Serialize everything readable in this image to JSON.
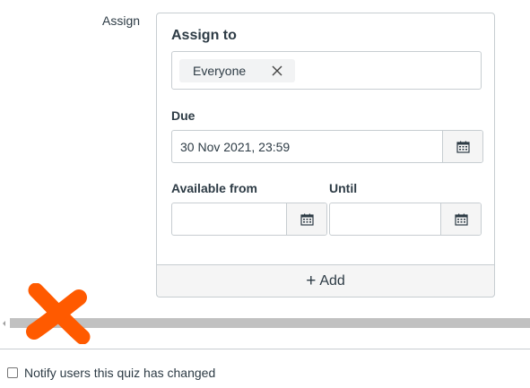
{
  "assign": {
    "section_label": "Assign",
    "card_title": "Assign to",
    "assignees": [
      "Everyone"
    ],
    "due_label": "Due",
    "due_value": "30 Nov 2021, 23:59",
    "available_from_label": "Available from",
    "available_from_value": "",
    "until_label": "Until",
    "until_value": "",
    "add_label": "Add"
  },
  "notify": {
    "label": "Notify users this quiz has changed",
    "checked": false
  },
  "colors": {
    "text": "#2d3b45",
    "border": "#c7cdd1",
    "button_bg": "#f5f5f5",
    "token_bg": "#f2f3f4",
    "scroll_thumb": "#c1c1c1",
    "annotation": "#ff5a00"
  },
  "icons": [
    "close-icon",
    "calendar-icon",
    "plus-icon",
    "scroll-left-arrow-icon"
  ]
}
